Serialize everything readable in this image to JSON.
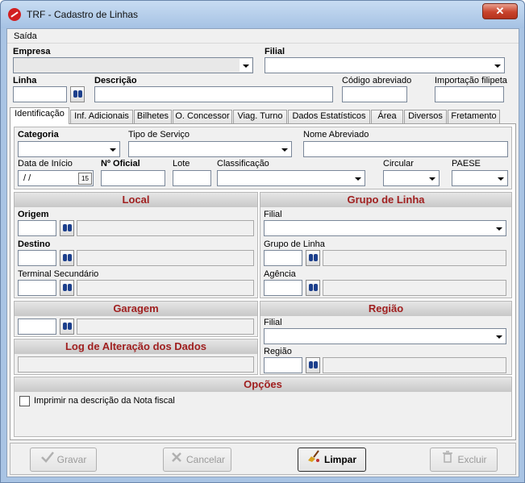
{
  "window": {
    "title": "TRF - Cadastro de Linhas",
    "close_glyph": "✕"
  },
  "menu": {
    "items": [
      "Saída"
    ]
  },
  "header": {
    "empresa_label": "Empresa",
    "filial_label": "Filial",
    "linha_label": "Linha",
    "descricao_label": "Descrição",
    "codigo_abreviado_label": "Código abreviado",
    "importacao_label": "Importação filipeta"
  },
  "tabs": [
    {
      "label": "Identificação"
    },
    {
      "label": "Inf. Adicionais"
    },
    {
      "label": "Bilhetes"
    },
    {
      "label": "O. Concessor"
    },
    {
      "label": "Viag. Turno"
    },
    {
      "label": "Dados Estatísticos"
    },
    {
      "label": "Área"
    },
    {
      "label": "Diversos"
    },
    {
      "label": "Fretamento"
    }
  ],
  "identificacao": {
    "categoria_label": "Categoria",
    "tipo_servico_label": "Tipo de Serviço",
    "nome_abreviado_label": "Nome Abreviado",
    "data_inicio_label": "Data de Início",
    "data_inicio_value": " / /",
    "calendar_glyph": "15",
    "numero_oficial_label": "Nº Oficial",
    "lote_label": "Lote",
    "classificacao_label": "Classificação",
    "circular_label": "Circular",
    "paese_label": "PAESE"
  },
  "local": {
    "title": "Local",
    "origem_label": "Origem",
    "destino_label": "Destino",
    "terminal_label": "Terminal Secundário"
  },
  "grupo_linha": {
    "title": "Grupo de Linha",
    "filial_label": "Filial",
    "grupo_label": "Grupo de Linha",
    "agencia_label": "Agência"
  },
  "garagem": {
    "title": "Garagem"
  },
  "log": {
    "title": "Log de Alteração dos Dados"
  },
  "regiao": {
    "title": "Região",
    "filial_label": "Filial",
    "regiao_label": "Região"
  },
  "opcoes": {
    "title": "Opções",
    "imprimir_label": "Imprimir na descrição da Nota fiscal",
    "imprimir_checked": false
  },
  "buttons": {
    "gravar": "Gravar",
    "cancelar": "Cancelar",
    "limpar": "Limpar",
    "excluir": "Excluir"
  },
  "icons": {
    "lookup": "binoculars-icon",
    "gravar": "checkmark-icon",
    "cancelar": "cancel-x-icon",
    "limpar": "broom-icon",
    "excluir": "trash-icon"
  },
  "colors": {
    "section_title": "#a02020",
    "title_bar": "#a9c4e4",
    "close_button": "#c8432c"
  }
}
